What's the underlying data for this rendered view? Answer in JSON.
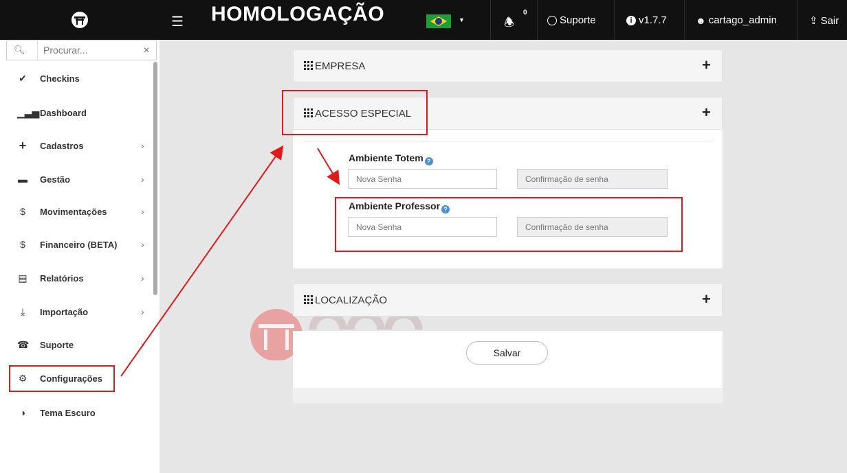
{
  "header": {
    "menu_icon": "hamburger-icon",
    "environment_title": "HOMOLOGAÇÃO",
    "language_flag": "brazil-flag",
    "notification_count": "0",
    "support_label": "Suporte",
    "version_label": "v1.7.7",
    "user_label": "cartago_admin",
    "logout_label": "Sair"
  },
  "sidebar": {
    "search_placeholder": "Procurar...",
    "items": [
      {
        "label": "Checkins",
        "icon": "check-icon",
        "has_submenu": false
      },
      {
        "label": "Dashboard",
        "icon": "bar-chart-icon",
        "has_submenu": false
      },
      {
        "label": "Cadastros",
        "icon": "plus-icon",
        "has_submenu": true
      },
      {
        "label": "Gestão",
        "icon": "briefcase-icon",
        "has_submenu": true
      },
      {
        "label": "Movimentações",
        "icon": "dollar-icon",
        "has_submenu": true
      },
      {
        "label": "Financeiro (BETA)",
        "icon": "dollar-icon",
        "has_submenu": true
      },
      {
        "label": "Relatórios",
        "icon": "list-icon",
        "has_submenu": true
      },
      {
        "label": "Importação",
        "icon": "import-icon",
        "has_submenu": true
      },
      {
        "label": "Suporte",
        "icon": "phone-icon",
        "has_submenu": true
      },
      {
        "label": "Configurações",
        "icon": "gear-icon",
        "has_submenu": false
      },
      {
        "label": "Tema Escuro",
        "icon": "half-circle-icon",
        "has_submenu": false
      }
    ]
  },
  "main": {
    "panels": [
      {
        "title": "EMPRESA",
        "toggle": "+"
      },
      {
        "title": "ACESSO ESPECIAL",
        "toggle": "+"
      },
      {
        "title": "LOCALIZAÇÃO",
        "toggle": "+"
      }
    ],
    "acesso_especial": {
      "totem": {
        "label": "Ambiente Totem",
        "new_password_placeholder": "Nova Senha",
        "confirm_password_placeholder": "Confirmação de senha"
      },
      "professor": {
        "label": "Ambiente Professor",
        "new_password_placeholder": "Nova Senha",
        "confirm_password_placeholder": "Confirmação de senha"
      }
    },
    "save_label": "Salvar"
  },
  "annotations": {
    "color": "#e01a1a",
    "note": "Red boxes and arrows highlight Configurações menu item, ACESSO ESPECIAL panel and Ambiente Professor field"
  },
  "colors": {
    "topbar": "#111111",
    "background": "#e6e6e6",
    "accent_red": "#e01a1a",
    "help_icon": "#4a8ed8"
  }
}
